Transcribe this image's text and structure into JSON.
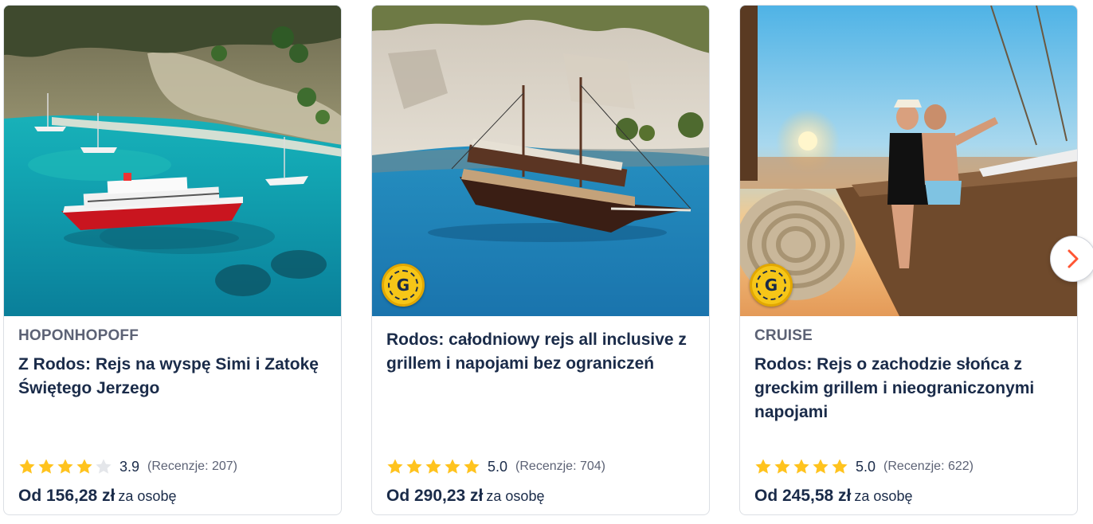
{
  "cards": [
    {
      "supplier": "HOPONHOPOFF",
      "title": "Z Rodos: Rejs na wyspę Simi i Zatokę Świętego Jerzego",
      "rating": 3.9,
      "rating_text": "3.9",
      "reviews": "(Recenzje: 207)",
      "price": "Od 156,28 zł",
      "price_suffix": "za osobę",
      "photo_icon": "boat-bay-photo"
    },
    {
      "supplier": "",
      "badge": "G",
      "title": "Rodos: całodniowy rejs all inclusive z grillem i napojami bez ograniczeń",
      "rating": 5.0,
      "rating_text": "5.0",
      "reviews": "(Recenzje: 704)",
      "price": "Od 290,23 zł",
      "price_suffix": "za osobę",
      "photo_icon": "pirate-ship-photo"
    },
    {
      "supplier": "CRUISE",
      "badge": "G",
      "title": "Rodos: Rejs o zachodzie słońca z greckim grillem i nieograniczonymi napojami",
      "rating": 5.0,
      "rating_text": "5.0",
      "reviews": "(Recenzje: 622)",
      "price": "Od 245,58 zł",
      "price_suffix": "za osobę",
      "photo_icon": "sunset-couple-photo"
    }
  ],
  "colors": {
    "text": "#1a2b49",
    "muted": "#5c6275",
    "star_filled": "#ffc31e",
    "star_empty": "#e4e6ea",
    "next_arrow": "#ff5533"
  },
  "navigation": {
    "next_icon": "chevron-right-icon"
  }
}
